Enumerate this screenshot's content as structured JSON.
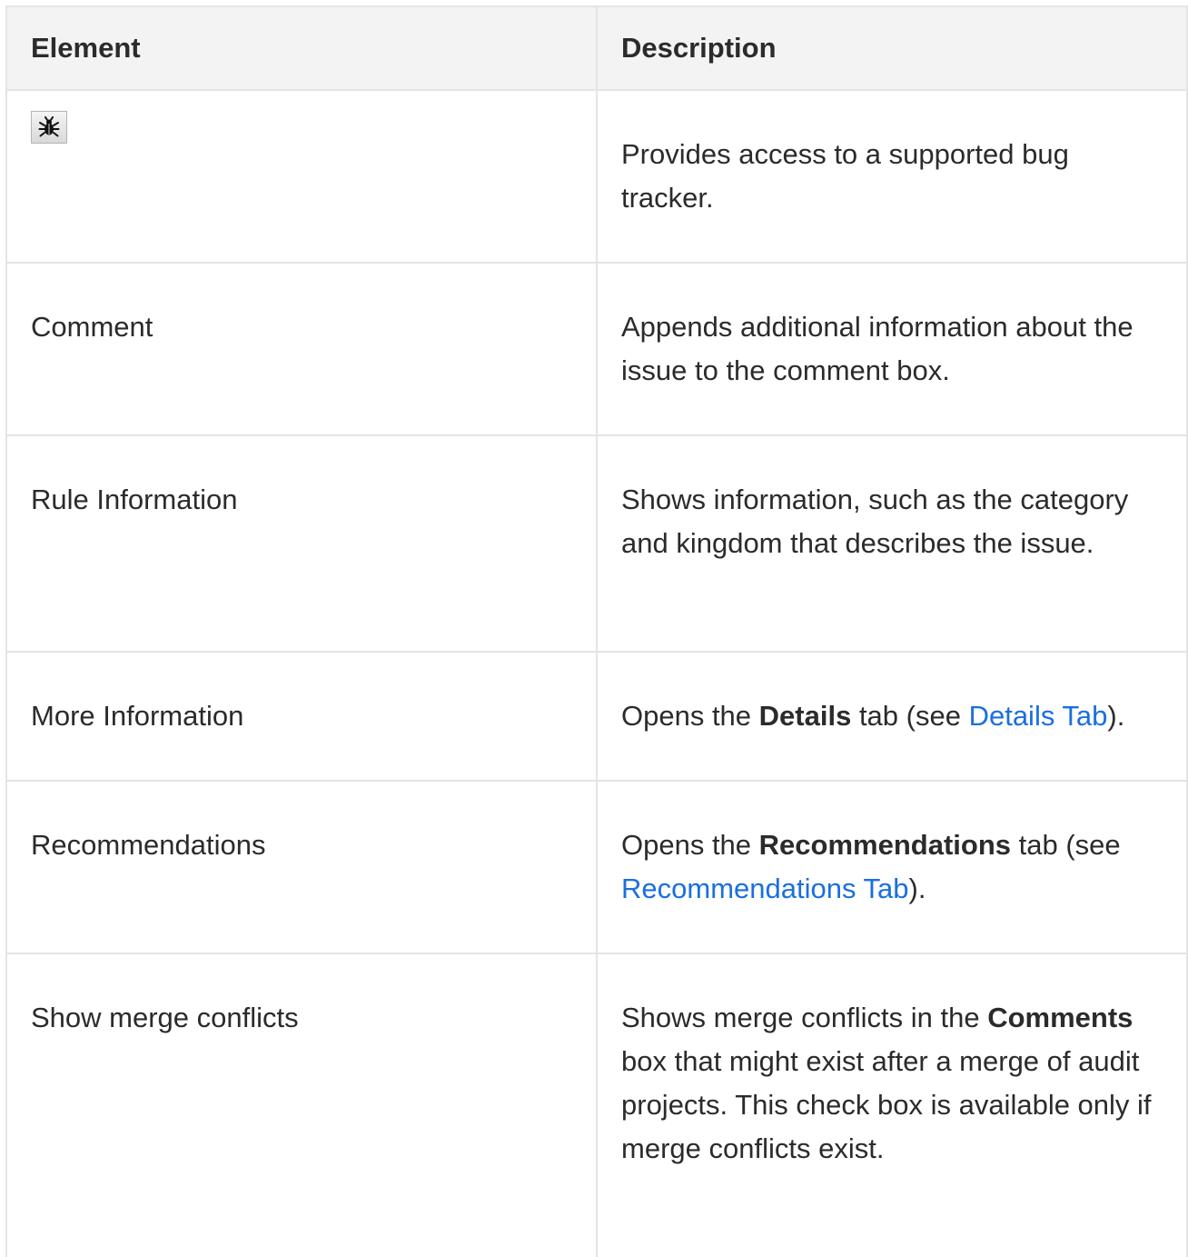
{
  "table": {
    "headers": {
      "element": "Element",
      "description": "Description"
    },
    "rows": [
      {
        "element_icon": "bug-tracker-icon",
        "description": "Provides access to a supported bug tracker."
      },
      {
        "element": "Comment",
        "description": "Appends additional information about the issue to the comment box."
      },
      {
        "element": "Rule Information",
        "description": "Shows information, such as the category and kingdom that describes the issue."
      },
      {
        "element": "More Information",
        "desc_pre": "Opens the ",
        "desc_bold": "Details",
        "desc_mid": " tab (see ",
        "desc_link": "Details Tab",
        "desc_post": ")."
      },
      {
        "element": "Recommendations",
        "desc_pre": "Opens the ",
        "desc_bold": "Recommendations",
        "desc_mid": " tab (see ",
        "desc_link": "Recommendations Tab",
        "desc_post": ")."
      },
      {
        "element": "Show merge conflicts",
        "desc_pre": "Shows merge conflicts in the ",
        "desc_bold": "Comments",
        "desc_post": " box that might exist after a merge of audit projects. This check box is available only if merge conflicts exist."
      }
    ]
  },
  "colors": {
    "link": "#1a6fe0",
    "header_bg": "#f3f3f3",
    "border": "#e4e4e4"
  }
}
